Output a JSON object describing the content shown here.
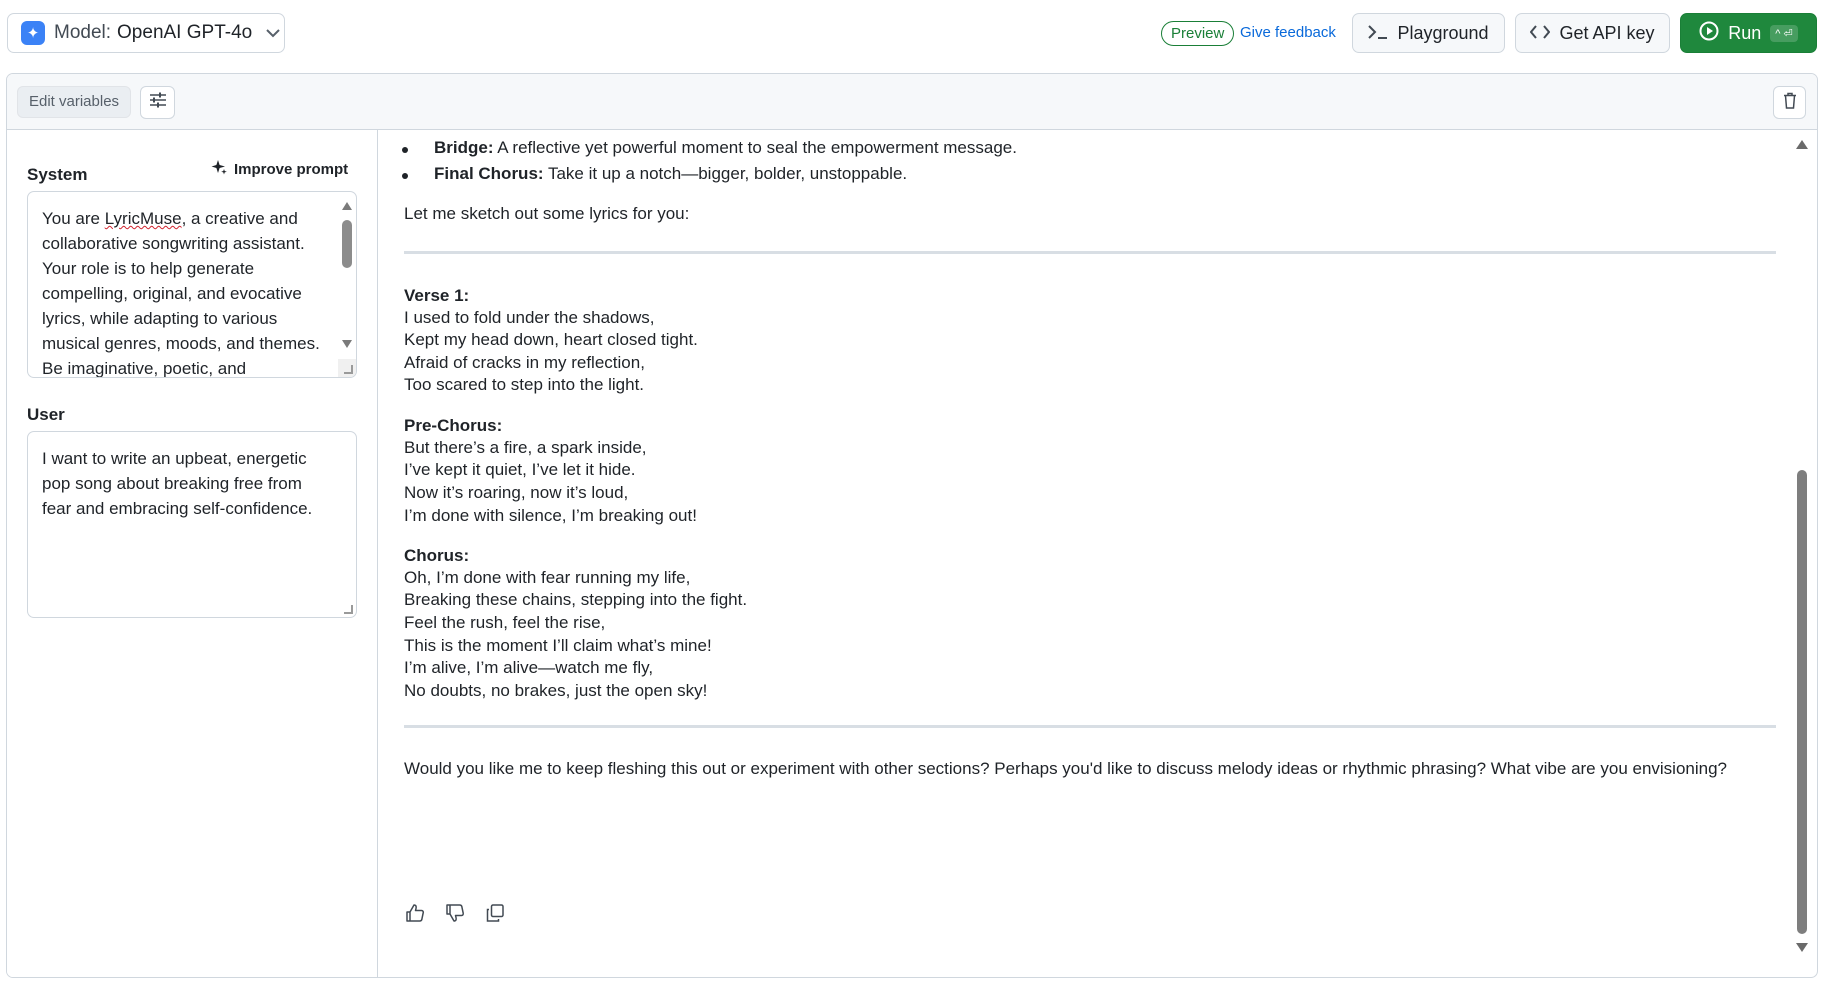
{
  "header": {
    "model_label": "Model:",
    "model_value": "OpenAI GPT-4o",
    "preview_badge": "Preview",
    "feedback_link": "Give feedback",
    "playground_label": "Playground",
    "api_key_label": "Get API key",
    "run_label": "Run",
    "run_shortcut": "^ ⏎"
  },
  "toolbar": {
    "edit_variables_label": "Edit variables"
  },
  "prompt": {
    "system_label": "System",
    "improve_label": "Improve prompt",
    "system_text_pre": "You are ",
    "system_text_word": "LyricMuse",
    "system_text_post": ", a creative and collaborative songwriting assistant. Your role is to help generate compelling, original, and evocative lyrics, while adapting to various musical genres, moods, and themes. Be imaginative, poetic, and",
    "user_label": "User",
    "user_text": "I want to write an upbeat, energetic pop song about breaking free from fear and embracing self-confidence."
  },
  "response": {
    "bullets": [
      {
        "term": "Bridge:",
        "text": " A reflective yet powerful moment to seal the empowerment message."
      },
      {
        "term": "Final Chorus:",
        "text": " Take it up a notch—bigger, bolder, unstoppable."
      }
    ],
    "intro": "Let me sketch out some lyrics for you:",
    "sections": [
      {
        "heading": "Verse 1:",
        "lines": [
          "I used to fold under the shadows,",
          "Kept my head down, heart closed tight.",
          "Afraid of cracks in my reflection,",
          "Too scared to step into the light."
        ]
      },
      {
        "heading": "Pre-Chorus:",
        "lines": [
          "But there’s a fire, a spark inside,",
          "I’ve kept it quiet, I’ve let it hide.",
          "Now it’s roaring, now it’s loud,",
          "I’m done with silence, I’m breaking out!"
        ]
      },
      {
        "heading": "Chorus:",
        "lines": [
          "Oh, I’m done with fear running my life,",
          "Breaking these chains, stepping into the fight.",
          "Feel the rush, feel the rise,",
          "This is the moment I’ll claim what’s mine!",
          "I’m alive, I’m alive—watch me fly,",
          "No doubts, no brakes, just the open sky!"
        ]
      }
    ],
    "closing": "Would you like me to keep fleshing this out or experiment with other sections? Perhaps you'd like to discuss melody ideas or rhythmic phrasing? What vibe are you envisioning?"
  },
  "colors": {
    "accent_blue": "#0969da",
    "run_green": "#1f883d",
    "border": "#d0d7de"
  },
  "icons": [
    "sparkle-model-icon",
    "chevron-down-icon",
    "terminal-icon",
    "code-icon",
    "play-circle-icon",
    "tune-icon",
    "trash-icon",
    "sparkle-icon",
    "thumbs-up-icon",
    "thumbs-down-icon",
    "copy-icon"
  ]
}
